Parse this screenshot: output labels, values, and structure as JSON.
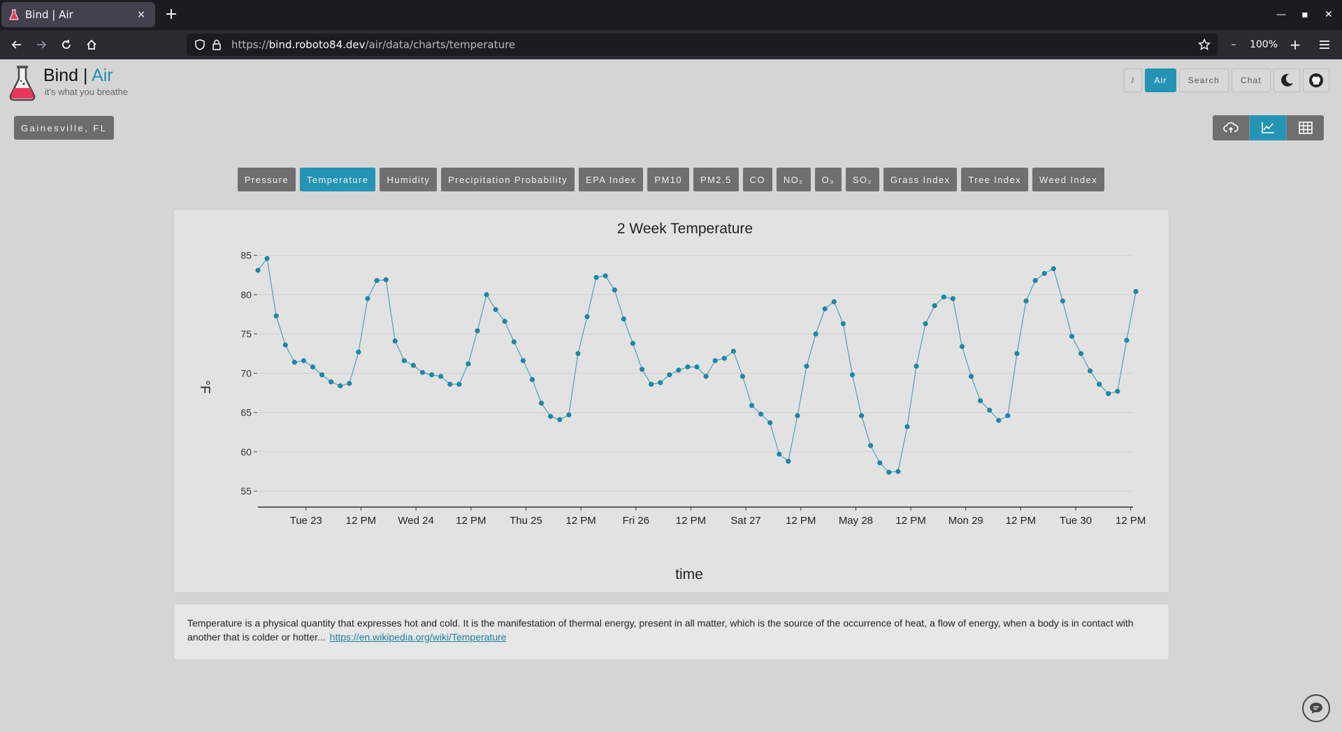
{
  "browser": {
    "tab_title": "Bind | Air",
    "url_host": "bind.roboto84.dev",
    "url_scheme": "https://",
    "url_path": "/air/data/charts/temperature",
    "zoom": "100%",
    "new_tab_label": "+",
    "zoom_out_label": "–",
    "zoom_in_label": "+"
  },
  "brand": {
    "title_main": "Bind",
    "title_sep": " | ",
    "title_accent": "Air",
    "tagline": "it's what you breathe"
  },
  "topnav": {
    "root_label": "/",
    "air_label": "Air",
    "search_label": "Search",
    "chat_label": "Chat"
  },
  "location": "Gainesville, FL",
  "metrics": [
    {
      "label": "Pressure",
      "active": false
    },
    {
      "label": "Temperature",
      "active": true
    },
    {
      "label": "Humidity",
      "active": false
    },
    {
      "label": "Precipitation Probability",
      "active": false
    },
    {
      "label": "EPA Index",
      "active": false
    },
    {
      "label": "PM10",
      "active": false
    },
    {
      "label": "PM2.5",
      "active": false
    },
    {
      "label": "CO",
      "active": false
    },
    {
      "label": "NO₂",
      "active": false
    },
    {
      "label": "O₃",
      "active": false
    },
    {
      "label": "SO₂",
      "active": false
    },
    {
      "label": "Grass Index",
      "active": false
    },
    {
      "label": "Tree Index",
      "active": false
    },
    {
      "label": "Weed Index",
      "active": false
    }
  ],
  "colors": {
    "accent": "#2494b4",
    "line": "#4aa3bd",
    "point": "#1c87a5",
    "logo_liquid": "#e8385a"
  },
  "chart_data": {
    "type": "line",
    "title": "2 Week Temperature",
    "xlabel": "time",
    "ylabel": "°F",
    "ylim": [
      53.5,
      85.5
    ],
    "yticks": [
      55,
      60,
      65,
      70,
      75,
      80,
      85
    ],
    "xticks": [
      "Tue 23",
      "12 PM",
      "Wed 24",
      "12 PM",
      "Thu 25",
      "12 PM",
      "Fri 26",
      "12 PM",
      "Sat 27",
      "12 PM",
      "May 28",
      "12 PM",
      "Mon 29",
      "12 PM",
      "Tue 30",
      "12 PM"
    ],
    "x_unit": "hours since first sample",
    "x_step_hours": 3,
    "xlim_hours": [
      0,
      191
    ],
    "grid": true,
    "values": [
      83.1,
      84.6,
      77.3,
      73.6,
      71.4,
      71.6,
      70.8,
      69.8,
      68.9,
      68.4,
      68.7,
      72.7,
      79.5,
      81.8,
      81.9,
      74.1,
      71.6,
      71.0,
      70.1,
      69.8,
      69.6,
      68.6,
      68.6,
      71.2,
      75.4,
      80.0,
      78.1,
      76.6,
      74.0,
      71.6,
      69.2,
      66.2,
      64.5,
      64.1,
      64.7,
      72.5,
      77.2,
      82.2,
      82.4,
      80.6,
      76.9,
      73.8,
      70.5,
      68.6,
      68.8,
      69.8,
      70.4,
      70.8,
      70.8,
      69.6,
      71.6,
      71.9,
      72.8,
      69.6,
      65.9,
      64.8,
      63.7,
      59.7,
      58.8,
      64.6,
      70.9,
      75.0,
      78.2,
      79.1,
      76.3,
      69.8,
      64.6,
      60.8,
      58.6,
      57.4,
      57.5,
      63.2,
      70.9,
      76.3,
      78.6,
      79.7,
      79.5,
      73.4,
      69.6,
      66.5,
      65.3,
      64.0,
      64.6,
      72.5,
      79.2,
      81.8,
      82.7,
      83.3,
      79.2,
      74.7,
      72.5,
      70.3,
      68.6,
      67.4,
      67.7,
      74.2,
      80.4
    ]
  },
  "description": {
    "text": "Temperature is a physical quantity that expresses hot and cold. It is the manifestation of thermal energy, present in all matter, which is the source of the occurrence of heat, a flow of energy, when a body is in contact with another that is colder or hotter...",
    "link": "https://en.wikipedia.org/wiki/Temperature"
  }
}
